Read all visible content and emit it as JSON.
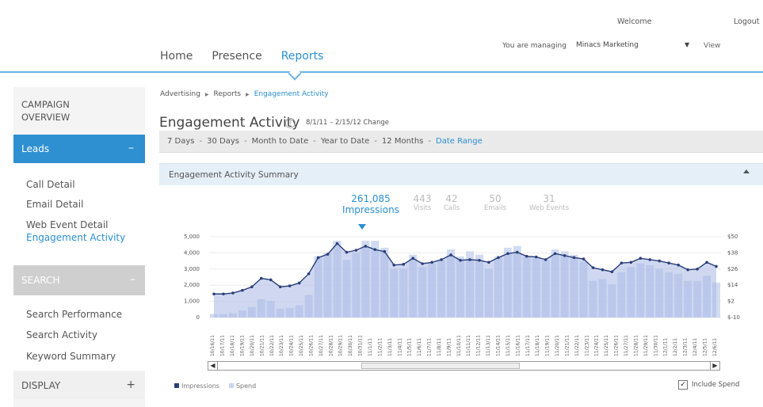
{
  "header": {
    "welcome": "Welcome",
    "logout": "Logout",
    "managing_label": "You are managing",
    "account": "Minacs Marketing",
    "view": "View",
    "nav": [
      {
        "label": "Home"
      },
      {
        "label": "Presence"
      },
      {
        "label": "Reports",
        "active": true
      }
    ]
  },
  "sidebar": {
    "campaign_overview": "CAMPAIGN\nOVERVIEW",
    "leads": {
      "label": "Leads",
      "toggle": "–"
    },
    "leads_items": [
      "Call Detail",
      "Email Detail",
      "Web Event Detail",
      "Engagement Activity"
    ],
    "search": {
      "label": "SEARCH",
      "toggle": "–"
    },
    "search_items": [
      "Search Performance",
      "Search Activity",
      "Keyword Summary"
    ],
    "display": {
      "label": "DISPLAY",
      "toggle": "+"
    }
  },
  "main": {
    "breadcrumb": [
      "Advertising",
      "Reports",
      "Engagement Activity"
    ],
    "title": "Engagement Activity",
    "help_icon": "?",
    "date_range_text": "8/1/11 – 2/15/12 Change",
    "ranges": [
      "7 Days",
      "30 Days",
      "Month to Date",
      "Year to Date",
      "12 Months"
    ],
    "range_link": "Date Range",
    "summary_title": "Engagement Activity Summary",
    "metrics": [
      {
        "value": "261,085",
        "label": "Impressions",
        "active": true
      },
      {
        "value": "443",
        "label": "Visits"
      },
      {
        "value": "42",
        "label": "Calls"
      },
      {
        "value": "50",
        "label": "Emails"
      },
      {
        "value": "31",
        "label": "Web Events"
      }
    ],
    "legend": {
      "impressions": "Impressions",
      "spend": "Spend"
    },
    "include_spend": "Include Spend"
  },
  "colors": {
    "accent": "#2a8fd0",
    "bar": "#c9d5ef",
    "area": "#a9b8e6",
    "line": "#2b3f7a"
  },
  "chart_data": {
    "type": "bar",
    "x": [
      "10/16/11",
      "10/17/11",
      "10/18/11",
      "10/19/11",
      "10/20/11",
      "10/21/11",
      "10/22/11",
      "10/23/11",
      "10/24/11",
      "10/25/11",
      "10/26/11",
      "10/27/11",
      "10/28/11",
      "10/29/11",
      "10/30/11",
      "10/31/11",
      "11/1/11",
      "11/2/11",
      "11/3/11",
      "11/4/11",
      "11/5/11",
      "11/6/11",
      "11/7/11",
      "11/8/11",
      "11/9/11",
      "11/10/11",
      "11/11/11",
      "11/12/11",
      "11/13/11",
      "11/14/11",
      "11/15/11",
      "11/16/11",
      "11/17/11",
      "11/18/11",
      "11/19/11",
      "11/20/11",
      "11/21/11",
      "11/22/11",
      "11/23/11",
      "11/24/11",
      "11/25/11",
      "11/26/11",
      "11/27/11",
      "11/28/11",
      "11/29/11",
      "11/30/11",
      "12/1/11",
      "12/2/11",
      "12/3/11",
      "12/4/11",
      "12/5/11",
      "12/6/11"
    ],
    "y_left_ticks": [
      "5,000",
      "4,000",
      "3,000",
      "2,000",
      "1,000",
      "0"
    ],
    "y_right_ticks": [
      "$50",
      "$38",
      "$26",
      "$14",
      "$2",
      "$-10"
    ],
    "series": [
      {
        "name": "Impressions",
        "values": [
          200,
          200,
          250,
          400,
          600,
          1050,
          950,
          500,
          550,
          700,
          1300,
          3500,
          3700,
          4400,
          3300,
          3700,
          4400,
          4400,
          4000,
          2800,
          2800,
          3600,
          2900,
          3100,
          3300,
          3900,
          3500,
          3800,
          3600,
          2800,
          3500,
          4000,
          4100,
          3500,
          3400,
          3300,
          3900,
          3800,
          3600,
          3200,
          2100,
          2200,
          1900,
          2600,
          2900,
          3100,
          3000,
          2800,
          2600,
          2500,
          2100,
          2100,
          2400,
          2000
        ]
      },
      {
        "name": "Spend",
        "values": [
          7.5,
          7.5,
          8.2,
          10.2,
          12.8,
          19.1,
          18.0,
          12.8,
          13.5,
          15.6,
          22.5,
          34.5,
          37.0,
          45.0,
          38.5,
          40.0,
          43.0,
          40.5,
          39.0,
          29.0,
          29.5,
          34.0,
          30.0,
          31.0,
          33.0,
          36.5,
          32.5,
          33.0,
          32.5,
          31.0,
          34.5,
          37.5,
          38.5,
          35.5,
          35.0,
          33.0,
          37.5,
          36.0,
          34.5,
          33.5,
          27.0,
          25.5,
          24.0,
          30.5,
          31.0,
          34.0,
          33.0,
          32.0,
          30.5,
          29.0,
          25.5,
          26.0,
          31.0,
          28.0
        ]
      }
    ],
    "ylim": [
      0,
      5000
    ]
  }
}
